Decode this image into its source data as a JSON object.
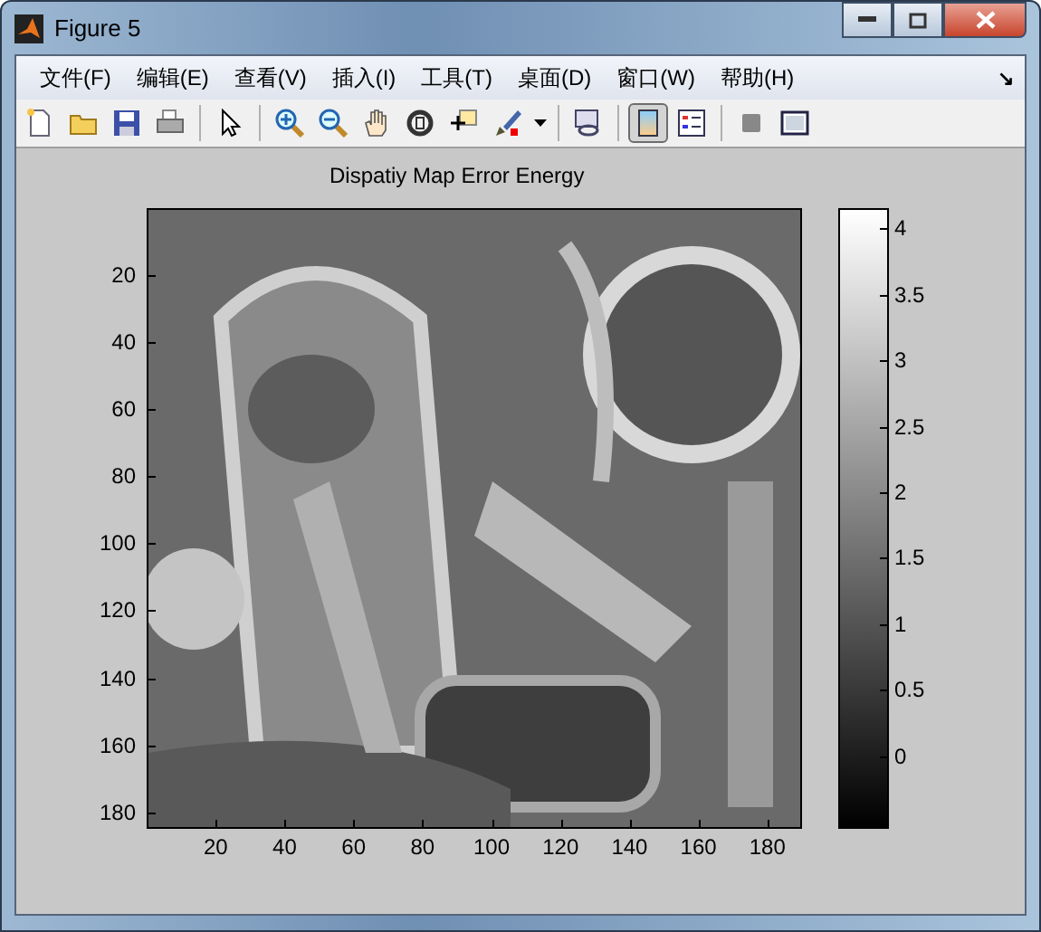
{
  "window": {
    "title": "Figure 5"
  },
  "menu": [
    "文件(F)",
    "编辑(E)",
    "查看(V)",
    "插入(I)",
    "工具(T)",
    "桌面(D)",
    "窗口(W)",
    "帮助(H)"
  ],
  "menu_corner": "↘",
  "toolbar": [
    [
      {
        "kind": "new",
        "selected": false
      },
      {
        "kind": "open",
        "selected": false
      },
      {
        "kind": "save",
        "selected": false
      },
      {
        "kind": "print",
        "selected": false
      }
    ],
    [
      {
        "kind": "pointer",
        "selected": false
      }
    ],
    [
      {
        "kind": "zoomin",
        "selected": false
      },
      {
        "kind": "zoomout",
        "selected": false
      },
      {
        "kind": "pan",
        "selected": false
      },
      {
        "kind": "rotate",
        "selected": false
      },
      {
        "kind": "cursor",
        "selected": false
      },
      {
        "kind": "brush",
        "selected": false
      },
      {
        "kind": "caret",
        "selected": false
      }
    ],
    [
      {
        "kind": "link",
        "selected": false
      }
    ],
    [
      {
        "kind": "colorbar",
        "selected": true
      },
      {
        "kind": "legend",
        "selected": false
      }
    ],
    [
      {
        "kind": "hide",
        "selected": false
      },
      {
        "kind": "show",
        "selected": false
      }
    ]
  ],
  "plot": {
    "title": "Dispatiy Map Error Energy",
    "yticks": [
      "20",
      "40",
      "60",
      "80",
      "100",
      "120",
      "140",
      "160",
      "180"
    ],
    "xticks": [
      "20",
      "40",
      "60",
      "80",
      "100",
      "120",
      "140",
      "160",
      "180"
    ],
    "colorbar_ticks": [
      "4",
      "3.5",
      "3",
      "2.5",
      "2",
      "1.5",
      "1",
      "0.5",
      "0"
    ]
  }
}
